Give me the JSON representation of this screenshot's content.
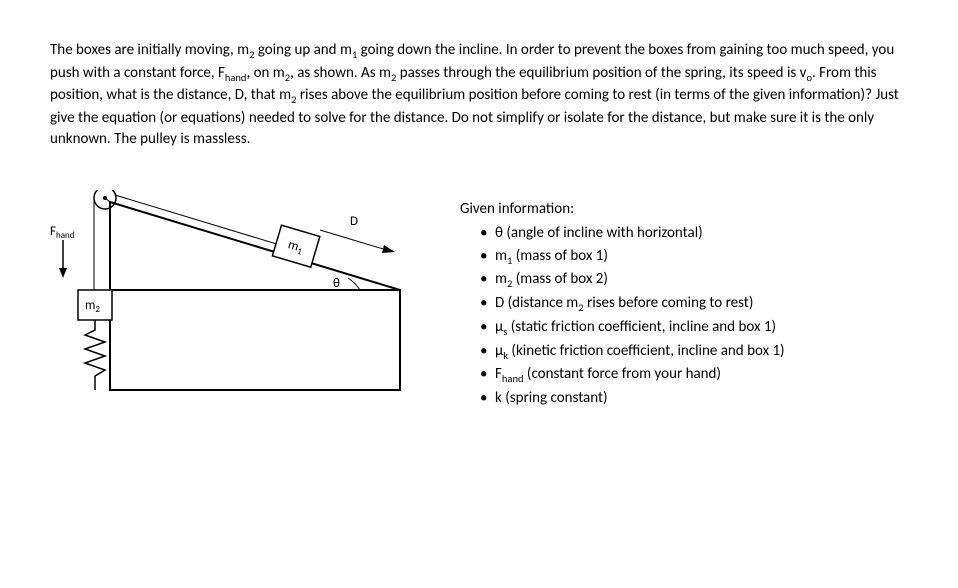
{
  "problem": {
    "text_html": "The boxes are initially moving, m<sub>2</sub> going up and m<sub>1</sub> going down the incline. In order to prevent the boxes from gaining too much speed, you push with a constant force, F<sub>hand</sub>, on m<sub>2</sub>, as shown. As m<sub>2</sub> passes through the equilibrium position of the spring, its speed is v<sub>o</sub>. From this position, what is the distance, D, that m<sub>2</sub> rises above the equilibrium position before coming to rest (in terms of the given information)? Just give the equation (or equations) needed to solve for the distance. Do not simplify or isolate for the distance, but make sure it is the only unknown. The pulley is massless."
  },
  "diagram": {
    "fhand_label": "F",
    "fhand_sub": "hand",
    "m1_label": "m",
    "m1_sub": "1",
    "m2_label": "m",
    "m2_sub": "2",
    "d_label": "D",
    "theta_label": "θ"
  },
  "given": {
    "title": "Given information:",
    "items": [
      "θ (angle of incline with horizontal)",
      "m<sub>1</sub> (mass of box 1)",
      "m<sub>2</sub> (mass of box 2)",
      "D (distance m<sub>2</sub> rises before coming to rest)",
      "μ<sub>s</sub> (static friction coefficient, incline and box 1)",
      "μ<sub>k</sub> (kinetic friction coefficient, incline and box 1)",
      "F<sub>hand</sub> (constant force from your hand)",
      "k (spring constant)"
    ]
  }
}
